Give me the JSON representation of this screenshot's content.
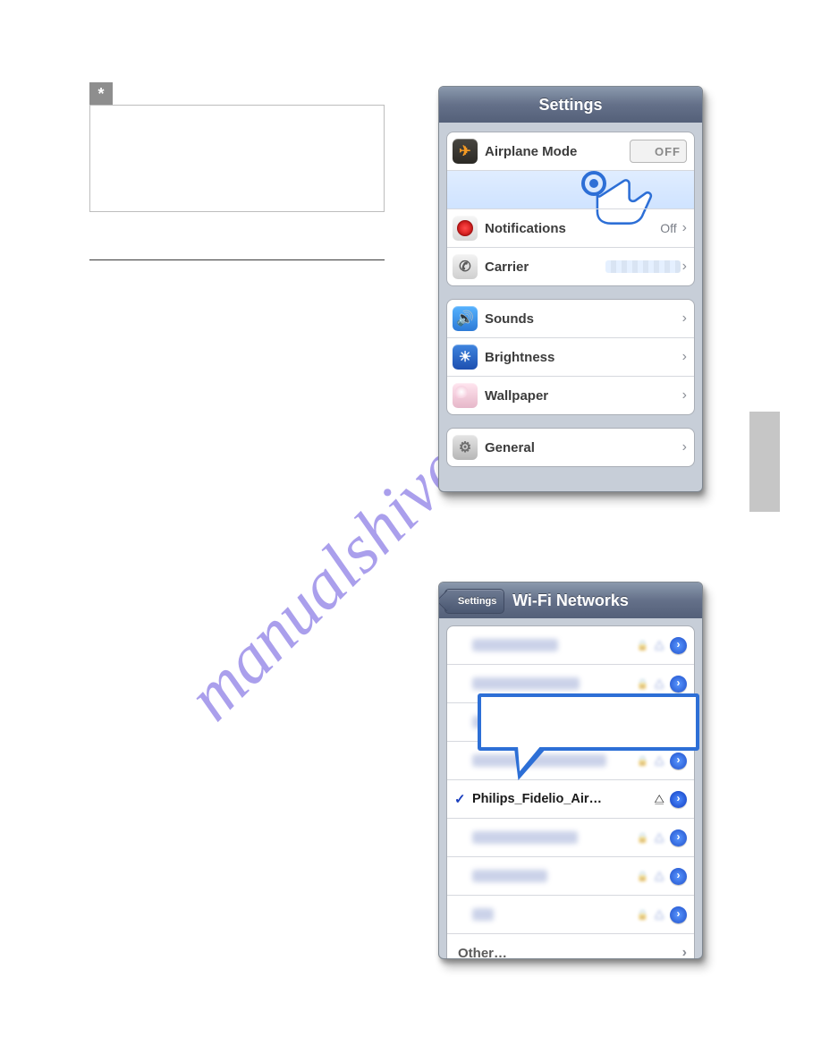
{
  "watermark_text": "manualshive.com",
  "noteStar": "*",
  "settings": {
    "title": "Settings",
    "airplane_label": "Airplane Mode",
    "airplane_switch_text": "OFF",
    "notifications_label": "Notifications",
    "notifications_value": "Off",
    "carrier_label": "Carrier",
    "sounds_label": "Sounds",
    "brightness_label": "Brightness",
    "wallpaper_label": "Wallpaper",
    "general_label": "General"
  },
  "wifi": {
    "back_label": "Settings",
    "title": "Wi-Fi Networks",
    "selected_name": "Philips_Fidelio_Air…",
    "other_label": "Other…"
  }
}
